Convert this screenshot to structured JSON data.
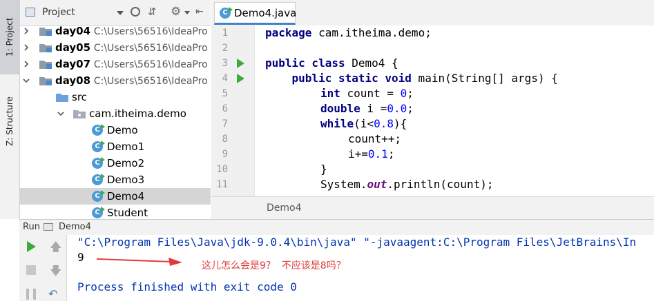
{
  "tool_stripe": {
    "project_tab": "1: Project",
    "structure_tab": "Z: Structure"
  },
  "project_panel": {
    "title": "Project",
    "tree": [
      {
        "type": "module",
        "name": "day04",
        "path": "C:\\Users\\56516\\IdeaPro",
        "expanded": false
      },
      {
        "type": "module",
        "name": "day05",
        "path": "C:\\Users\\56516\\IdeaPro",
        "expanded": false
      },
      {
        "type": "module",
        "name": "day07",
        "path": "C:\\Users\\56516\\IdeaPro",
        "expanded": false
      },
      {
        "type": "module",
        "name": "day08",
        "path": "C:\\Users\\56516\\IdeaPro",
        "expanded": true
      },
      {
        "type": "folder",
        "name": "src"
      },
      {
        "type": "package",
        "name": "cam.itheima.demo"
      },
      {
        "type": "class",
        "name": "Demo"
      },
      {
        "type": "class",
        "name": "Demo1"
      },
      {
        "type": "class",
        "name": "Demo2"
      },
      {
        "type": "class",
        "name": "Demo3"
      },
      {
        "type": "class",
        "name": "Demo4",
        "selected": true
      },
      {
        "type": "class",
        "name": "Student"
      }
    ]
  },
  "editor": {
    "tab_label": "Demo4.java",
    "line_numbers": [
      "1",
      "2",
      "3",
      "4",
      "5",
      "6",
      "7",
      "8",
      "9",
      "10",
      "11"
    ],
    "code": {
      "l1_kw": "package",
      "l1_rest": " cam.itheima.demo;",
      "l3_kw": "public class",
      "l3_rest": " Demo4 {",
      "l4_indent": "    ",
      "l4_kw": "public static void",
      "l4_rest": " main(String[] args) {",
      "l5_kw": "int",
      "l5_mid": " count = ",
      "l5_num": "0",
      "l5_end": ";",
      "l6_kw": "double",
      "l6_mid": " i =",
      "l6_num": "0.0",
      "l6_end": ";",
      "l7_kw": "while",
      "l7_mid": "(i<",
      "l7_num": "0.8",
      "l7_end": "){",
      "l8": "count++;",
      "l9_mid": "i+=",
      "l9_num": "0.1",
      "l9_end": ";",
      "l10": "}",
      "l11_a": "System.",
      "l11_fld": "out",
      "l11_b": ".println(count);"
    },
    "breadcrumb": "Demo4"
  },
  "run_panel": {
    "label": "Run",
    "config": "Demo4",
    "console_lines": {
      "command": "\"C:\\Program Files\\Java\\jdk-9.0.4\\bin\\java\" \"-javaagent:C:\\Program Files\\JetBrains\\In",
      "output": "9",
      "exit": "Process finished with exit code 0"
    },
    "annotation": "这儿怎么会是9？  不应该是8吗？"
  },
  "colors": {
    "accent": "#4083c9",
    "run_green": "#3bab3b",
    "keyword": "#000080",
    "number": "#0000ff",
    "annotation_red": "#e03a3a"
  }
}
